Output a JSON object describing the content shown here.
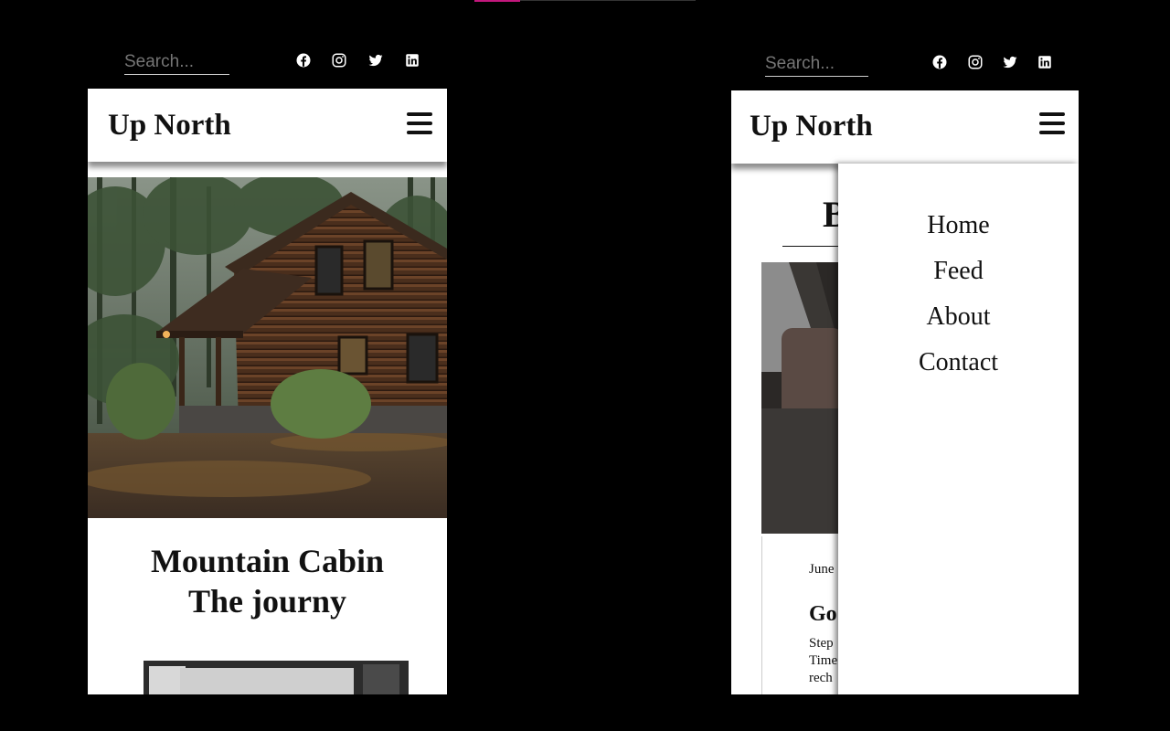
{
  "left_view": {
    "search_placeholder": "Search...",
    "brand": "Up North",
    "post_title_line1": "Mountain Cabin",
    "post_title_line2": "The journy"
  },
  "right_view": {
    "search_placeholder": "Search...",
    "brand": "Up North",
    "heading_fragment": "B",
    "date_fragment": "June",
    "post_title_fragment": "Go",
    "excerpt_fragments": [
      "Step",
      "Time",
      "rech"
    ],
    "nav": [
      "Home",
      "Feed",
      "About",
      "Contact"
    ]
  },
  "icons": [
    "facebook-icon",
    "instagram-icon",
    "twitter-icon",
    "linkedin-icon"
  ],
  "colors": {
    "background": "#000000",
    "surface": "#ffffff",
    "accent": "#c2177c",
    "text": "#111111",
    "placeholder": "#9a9a9a"
  }
}
